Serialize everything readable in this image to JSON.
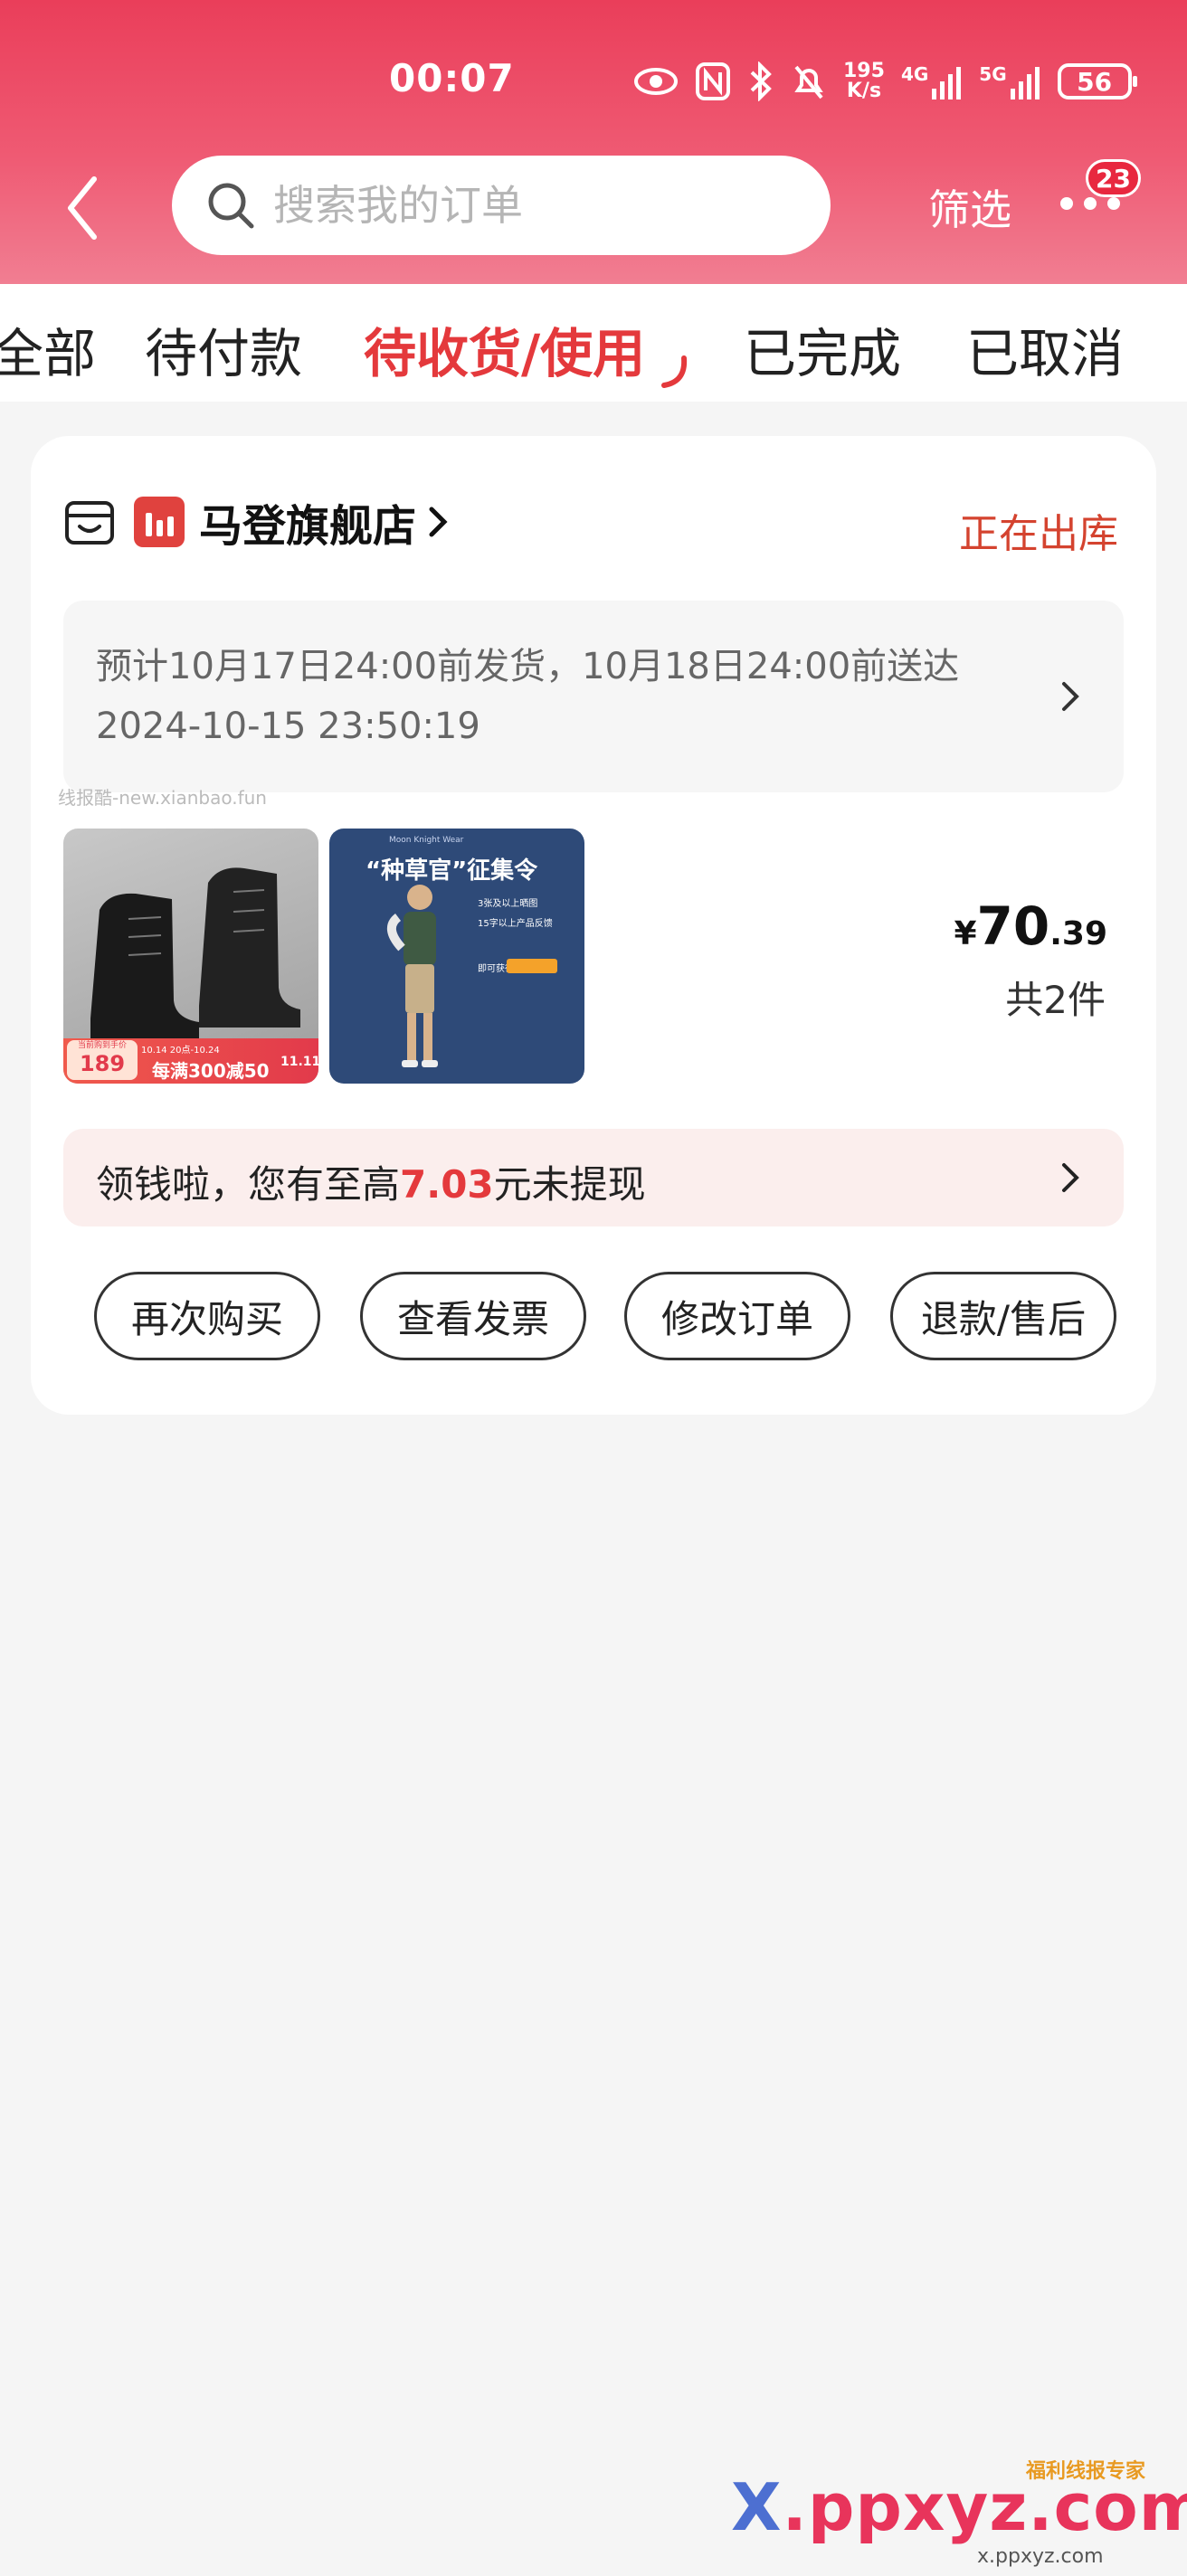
{
  "status_bar": {
    "time": "00:07",
    "net_speed_value": "195",
    "net_speed_unit": "K/s",
    "network_1": "4G",
    "network_2": "5G",
    "battery": "56"
  },
  "header": {
    "search_placeholder": "搜索我的订单",
    "filter_label": "筛选",
    "message_badge": "23",
    "background_color": "#ea3e5a"
  },
  "tabs": [
    {
      "label": "全部",
      "active": false
    },
    {
      "label": "待付款",
      "active": false
    },
    {
      "label": "待收货/使用",
      "active": true
    },
    {
      "label": "已完成",
      "active": false
    },
    {
      "label": "已取消",
      "active": false
    }
  ],
  "order": {
    "shop_name": "马登旗舰店",
    "status": "正在出库",
    "delivery_line1": "预计10月17日24:00前发货，10月18日24:00前送达",
    "delivery_line2": "2024-10-15 23:50:19",
    "watermark": "线报酷-new.xianbao.fun",
    "price_symbol": "¥",
    "price_int": "70",
    "price_dec": ".39",
    "item_count": "共2件",
    "product1": {
      "tag_label": "当前购到手价",
      "tag_price": "189",
      "date_range": "10.14 20点-10.24",
      "promo": "每满300减50",
      "event": "11.11"
    },
    "product2": {
      "headline": "“种草官”征集令",
      "sub1": "3张及以上晒图",
      "sub2": "15字以上产品反馈",
      "sub3": "即可获得",
      "top_text": "Moon Knight Wear"
    }
  },
  "cash_banner": {
    "prefix": "领钱啦，您有至高",
    "amount": "7.03",
    "suffix": "元未提现"
  },
  "actions": {
    "rebuy": "再次购买",
    "invoice": "查看发票",
    "modify": "修改订单",
    "refund": "退款/售后"
  },
  "footer": {
    "site_x": "X",
    "site_rest": ".ppxyz.com",
    "site_sub": "x.ppxyz.com",
    "site_tag": "福利线报专家"
  },
  "colors": {
    "accent": "#e4393c",
    "status_text": "#d4432f",
    "banner_bg": "#fbeeed"
  }
}
